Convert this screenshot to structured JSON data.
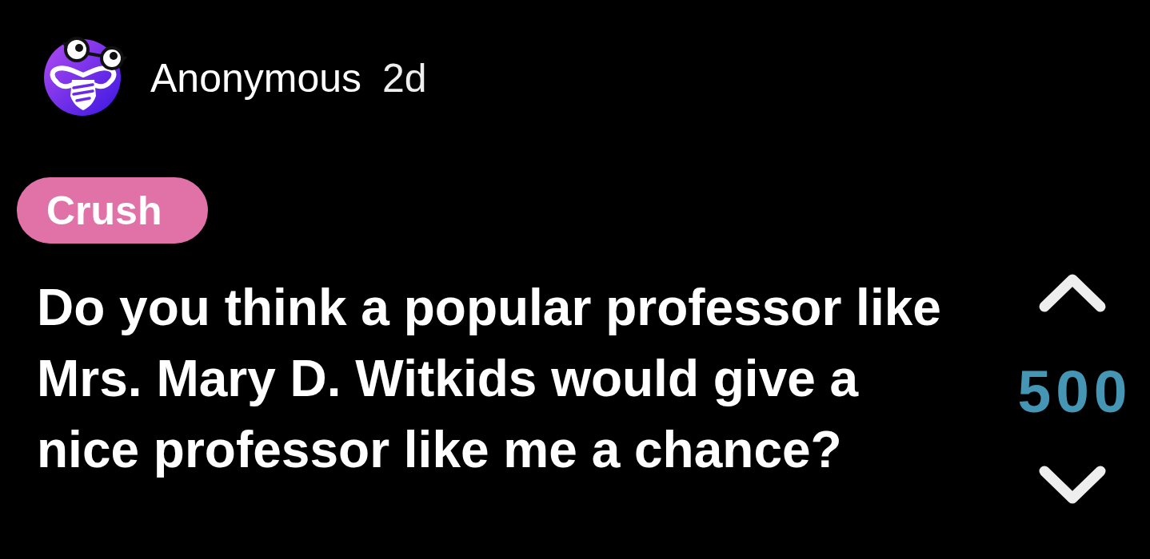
{
  "post": {
    "author": "Anonymous",
    "time": "2d",
    "tag": {
      "label": "Crush"
    },
    "question": "Do you think a popular professor like Mrs. Mary D. Witkids would give a nice professor like me a chance?",
    "votes": {
      "count": "500"
    }
  }
}
